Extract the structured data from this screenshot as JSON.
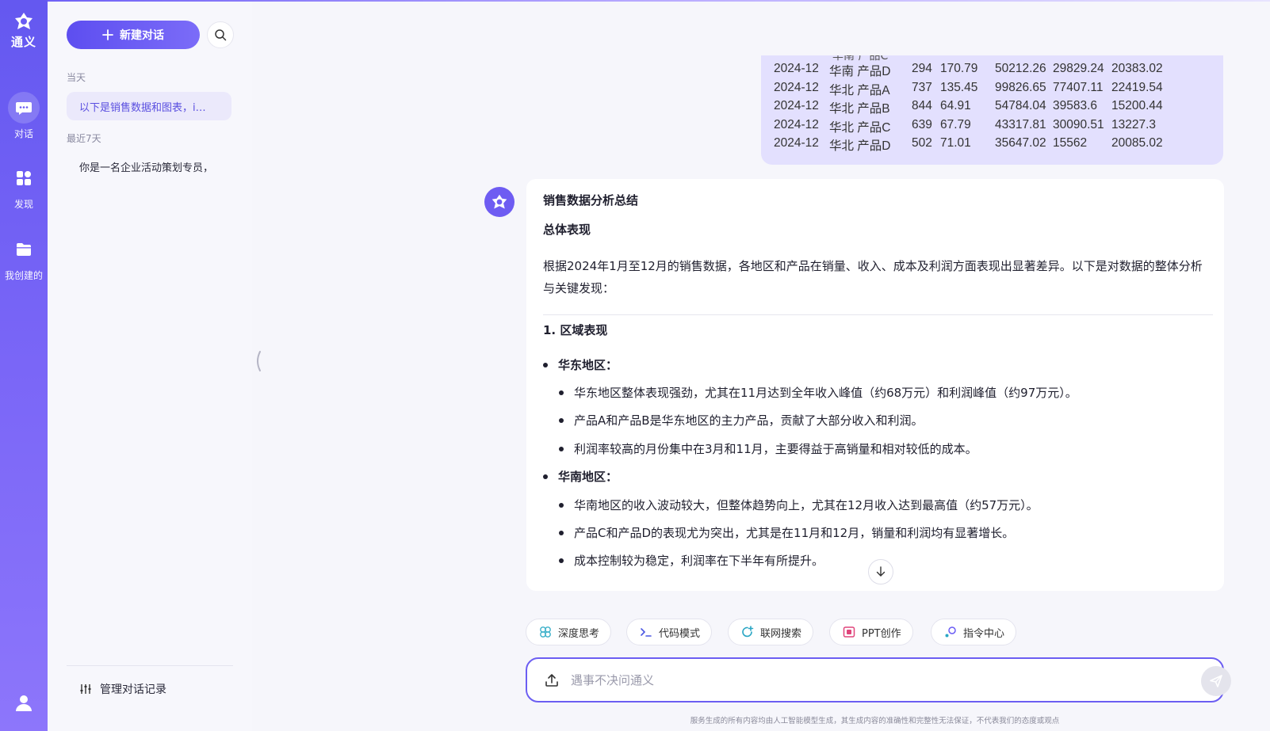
{
  "rail": {
    "logo_text": "通义",
    "items": [
      {
        "label": "对话",
        "icon": "chat-icon"
      },
      {
        "label": "发现",
        "icon": "grid-icon"
      },
      {
        "label": "我创建的",
        "icon": "folder-icon"
      }
    ],
    "user_icon": "user-icon"
  },
  "sidebar": {
    "new_chat_label": "新建对话",
    "today_label": "当天",
    "recent_label": "最近7天",
    "conversations": [
      {
        "title": "以下是销售数据和图表，i…",
        "active": true
      },
      {
        "title": "你是一名企业活动策划专员，",
        "active": false
      }
    ],
    "manage_label": "管理对话记录"
  },
  "user_message": {
    "cut_line": "华南 产品C",
    "rows": [
      [
        "2024-12",
        "华南 产品D",
        "294",
        "170.79",
        "50212.26",
        "29829.24",
        "20383.02"
      ],
      [
        "2024-12",
        "华北 产品A",
        "737",
        "135.45",
        "99826.65",
        "77407.11",
        "22419.54"
      ],
      [
        "2024-12",
        "华北 产品B",
        "844",
        "64.91",
        "54784.04",
        "39583.6",
        "15200.44"
      ],
      [
        "2024-12",
        "华北 产品C",
        "639",
        "67.79",
        "43317.81",
        "30090.51",
        "13227.3"
      ],
      [
        "2024-12",
        "华北 产品D",
        "502",
        "71.01",
        "35647.02",
        "15562",
        "20085.02"
      ]
    ]
  },
  "bot_message": {
    "title": "销售数据分析总结",
    "subtitle": "总体表现",
    "intro": "根据2024年1月至12月的销售数据，各地区和产品在销量、收入、成本及利润方面表现出显著差异。以下是对数据的整体分析与关键发现：",
    "section1": "1. 区域表现",
    "east_label": "华东地区：",
    "east_items": [
      "华东地区整体表现强劲，尤其在11月达到全年收入峰值（约68万元）和利润峰值（约97万元）。",
      "产品A和产品B是华东地区的主力产品，贡献了大部分收入和利润。",
      "利润率较高的月份集中在3月和11月，主要得益于高销量和相对较低的成本。"
    ],
    "south_label": "华南地区：",
    "south_items": [
      "华南地区的收入波动较大，但整体趋势向上，尤其在12月收入达到最高值（约57万元）。",
      "产品C和产品D的表现尤为突出，尤其是在11月和12月，销量和利润均有显著增长。",
      "成本控制较为稳定，利润率在下半年有所提升。"
    ]
  },
  "tools": [
    {
      "label": "深度思考",
      "icon": "deep-think-icon",
      "color": "#3bb0c9"
    },
    {
      "label": "代码模式",
      "icon": "code-icon",
      "color": "#4a56e2"
    },
    {
      "label": "联网搜索",
      "icon": "web-search-icon",
      "color": "#2aa6c4"
    },
    {
      "label": "PPT创作",
      "icon": "ppt-icon",
      "color": "#e0457b"
    },
    {
      "label": "指令中心",
      "icon": "command-icon",
      "color": "#6a5cf5"
    }
  ],
  "composer": {
    "placeholder": "遇事不决问通义"
  },
  "disclaimer": "服务生成的所有内容均由人工智能模型生成，其生成内容的准确性和完整性无法保证，不代表我们的态度或观点",
  "colors": {
    "accent": "#6c5ef2",
    "rail_top": "#6458f0",
    "user_bubble": "#e3e0fe"
  }
}
